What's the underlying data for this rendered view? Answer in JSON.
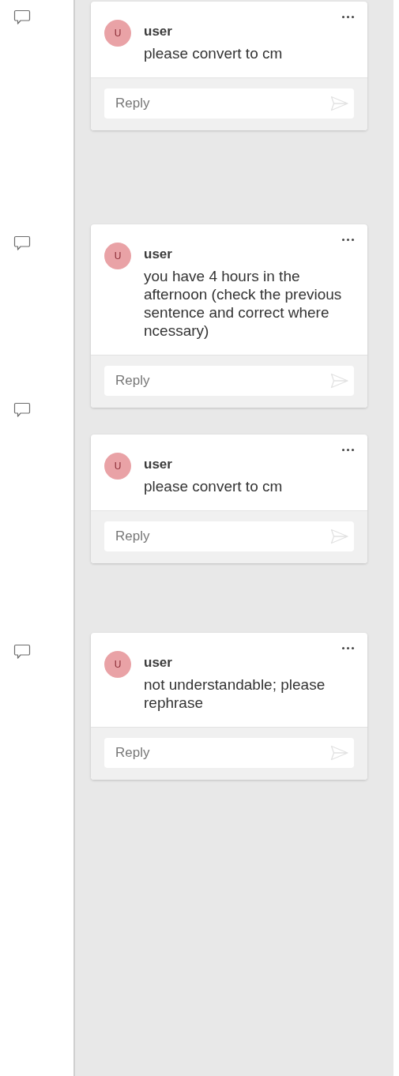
{
  "comments": [
    {
      "avatar": "U",
      "author": "user",
      "text": "please convert to cm",
      "reply_placeholder": "Reply"
    },
    {
      "avatar": "U",
      "author": "user",
      "text": "you have 4 hours in the afternoon (check the previous sentence and correct where ncessary)",
      "reply_placeholder": "Reply"
    },
    {
      "avatar": "U",
      "author": "user",
      "text": "please convert to cm",
      "reply_placeholder": "Reply"
    },
    {
      "avatar": "U",
      "author": "user",
      "text": "not understandable; please rephrase",
      "reply_placeholder": "Reply"
    }
  ]
}
